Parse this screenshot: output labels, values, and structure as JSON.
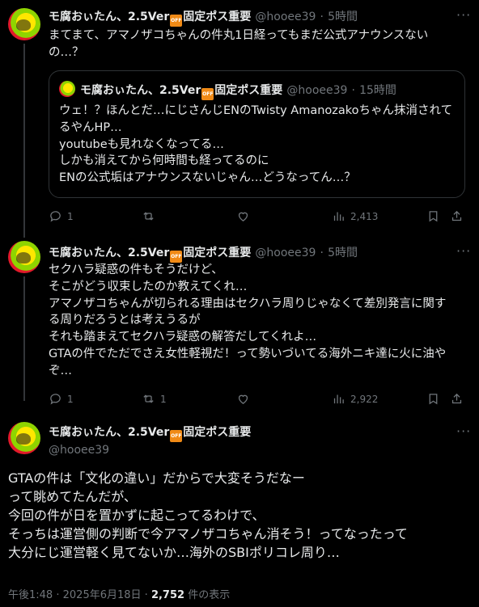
{
  "tweets": [
    {
      "name": "モ腐おぃたん、2.5Ver",
      "name_suffix": "固定ポス重要",
      "handle": "@hooee39",
      "sep": "·",
      "time": "5時間",
      "lines": [
        "まてまて、アマノザコちゃんの件丸1日経ってもまだ公式アナウンスない",
        "の…？"
      ],
      "quote": {
        "name": "モ腐おぃたん、2.5Ver",
        "name_suffix": "固定ポス重要",
        "handle": "@hooee39",
        "sep": "·",
        "time": "15時間",
        "lines": [
          "ウェ！？ほんとだ…にじさんじENのTwisty Amanozakoちゃん抹消されて",
          "るやんHP…",
          "youtubeも見れなくなってる…",
          "しかも消えてから何時間も経ってるのに",
          "ENの公式垢はアナウンスないじゃん…どうなってん…？"
        ]
      },
      "replies": "1",
      "retweets": "",
      "views": "2,413"
    },
    {
      "name": "モ腐おぃたん、2.5Ver",
      "name_suffix": "固定ポス重要",
      "handle": "@hooee39",
      "sep": "·",
      "time": "5時間",
      "lines": [
        "セクハラ疑惑の件もそうだけど、",
        "そこがどう収束したのか教えてくれ…",
        "アマノザコちゃんが切られる理由はセクハラ周りじゃなくて差別発言に関す",
        "る周りだろうとは考えうるが",
        "それも踏まえてセクハラ疑惑の解答だしてくれよ…",
        "GTAの件でただでさえ女性軽視だ！って勢いづいてる海外ニキ達に火に油や",
        "ぞ…"
      ],
      "replies": "1",
      "retweets": "1",
      "views": "2,922"
    }
  ],
  "main": {
    "name": "モ腐おぃたん、2.5Ver",
    "name_suffix": "固定ポス重要",
    "handle": "@hooee39",
    "lines": [
      "GTAの件は「文化の違い」だからで大変そうだなー",
      "って眺めてたんだが、",
      "今回の件が日を置かずに起こってるわけで、",
      "そっちは運営側の判断で今アマノザコちゃん消そう！ってなったって",
      "大分にじ運営軽く見てないか…海外のSBIポリコレ周り…"
    ],
    "time": "午後1:48",
    "sep": "·",
    "date": "2025年6月18日",
    "views": "2,752",
    "views_label": "件の表示"
  },
  "icons": {
    "off_badge": "OFF",
    "more": "···"
  },
  "colors": {
    "background": "#000000",
    "text": "#e7e9ea",
    "secondary": "#71767b",
    "border": "#2f3336",
    "badge": "#f08a16"
  }
}
